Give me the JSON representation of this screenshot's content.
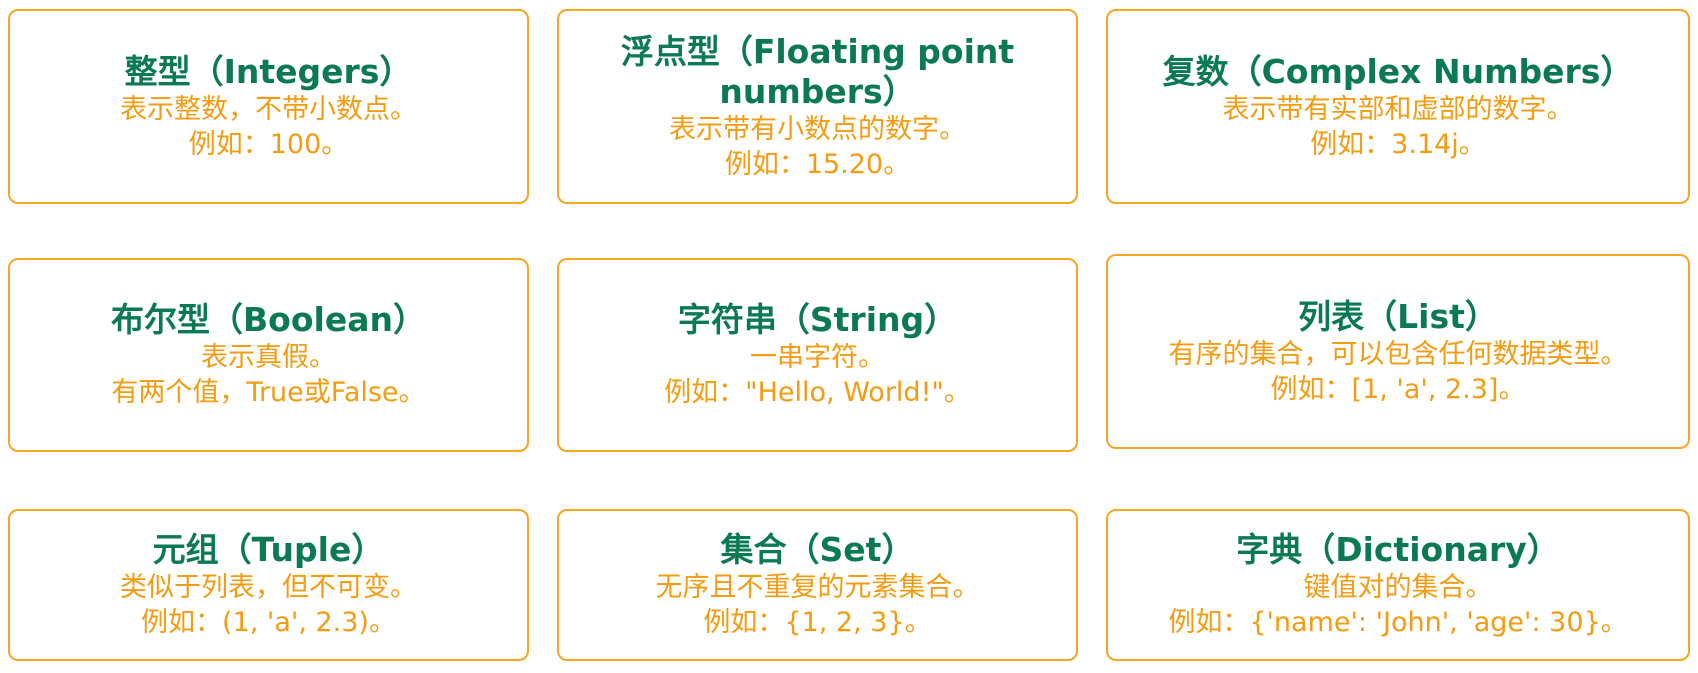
{
  "colors": {
    "border": "#f5a623",
    "title": "#0b7a52",
    "text": "#f39c12",
    "background": "#ffffff"
  },
  "cards": [
    {
      "title": "整型（Integers）",
      "lines": [
        "表示整数，不带小数点。",
        "例如：100。"
      ]
    },
    {
      "title": "浮点型（Floating point numbers）",
      "lines": [
        "表示带有小数点的数字。",
        "例如：15.20。"
      ]
    },
    {
      "title": "复数（Complex Numbers）",
      "lines": [
        "表示带有实部和虚部的数字。",
        "例如：3.14j。"
      ]
    },
    {
      "title": "布尔型（Boolean）",
      "lines": [
        "表示真假。",
        "有两个值，True或False。"
      ]
    },
    {
      "title": "字符串（String）",
      "lines": [
        "一串字符。",
        "例如：\"Hello, World!\"。"
      ]
    },
    {
      "title": "列表（List）",
      "lines": [
        "有序的集合，可以包含任何数据类型。",
        "例如：[1, 'a', 2.3]。"
      ]
    },
    {
      "title": "元组（Tuple）",
      "lines": [
        "类似于列表，但不可变。",
        "例如：(1, 'a', 2.3)。"
      ]
    },
    {
      "title": "集合（Set）",
      "lines": [
        "无序且不重复的元素集合。",
        "例如：{1, 2, 3}。"
      ]
    },
    {
      "title": "字典（Dictionary）",
      "lines": [
        "键值对的集合。",
        "例如：{'name': 'John', 'age': 30}。"
      ]
    }
  ]
}
